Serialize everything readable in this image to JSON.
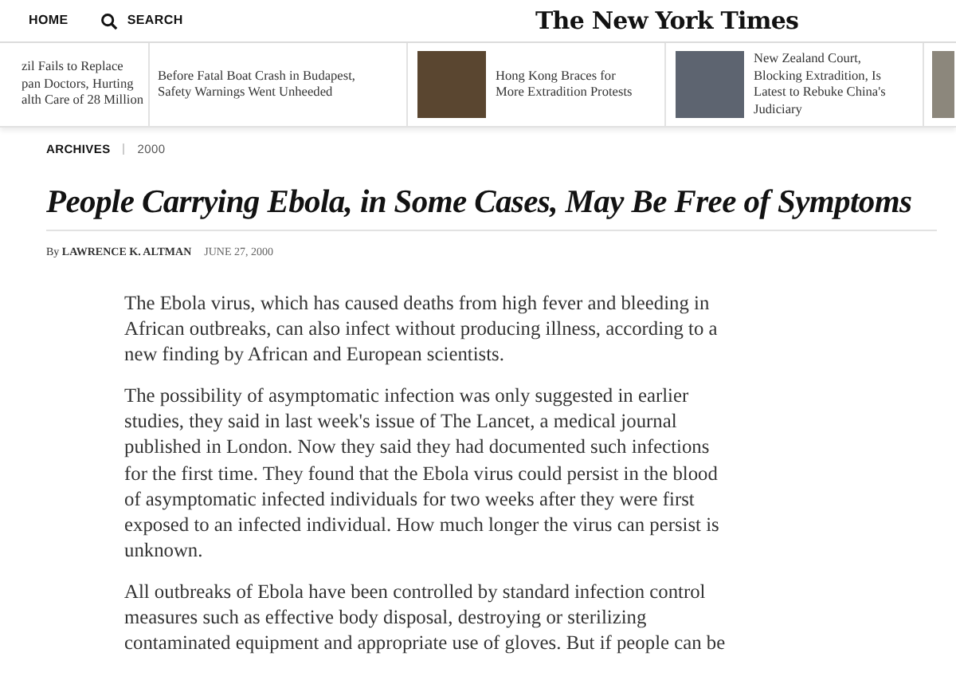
{
  "nav": {
    "items": [
      {
        "kind": "home",
        "label": "HOME"
      },
      {
        "kind": "search",
        "label": "SEARCH"
      }
    ],
    "masthead": "The New York Times"
  },
  "stories": [
    {
      "lines": [
        "zil Fails to Replace",
        "pan Doctors, Hurting",
        "alth Care of 28 Million"
      ],
      "photo": false
    },
    {
      "lines": [
        "Before Fatal Boat Crash in Budapest,",
        "Safety Warnings Went Unheeded"
      ],
      "photo": false
    },
    {
      "lines": [
        "Hong Kong Braces for",
        "More Extradition Protests"
      ],
      "photo": true
    },
    {
      "lines": [
        "New Zealand Court,",
        "Blocking Extradition, Is",
        "Latest to Rebuke China's",
        "Judiciary"
      ],
      "photo": true
    },
    {
      "photo": true
    }
  ],
  "section": {
    "label": "ARCHIVES",
    "year": "2000"
  },
  "headline": "People Carrying Ebola, in Some Cases, May Be Free of Symptoms",
  "byline": {
    "prefix": "By",
    "author": "LAWRENCE K. ALTMAN",
    "date": "JUNE 27, 2000"
  },
  "paragraphs": [
    "The Ebola virus, which has caused deaths from high fever and bleeding in African outbreaks, can also infect without producing illness, according to a new finding by African and European scientists.",
    "The possibility of asymptomatic infection was only suggested in earlier studies, they said in last week's issue of The Lancet, a medical journal published in London. Now they said they had documented such infections for the first time. They found that the Ebola virus could persist in the blood of asymptomatic infected individuals for two weeks after they were first exposed to an infected individual. How much longer the virus can persist is unknown.",
    "All outbreaks of Ebola have been controlled by standard infection control measures such as effective body disposal, destroying or sterilizing contaminated equipment and appropriate use of gloves. But if people can be"
  ]
}
